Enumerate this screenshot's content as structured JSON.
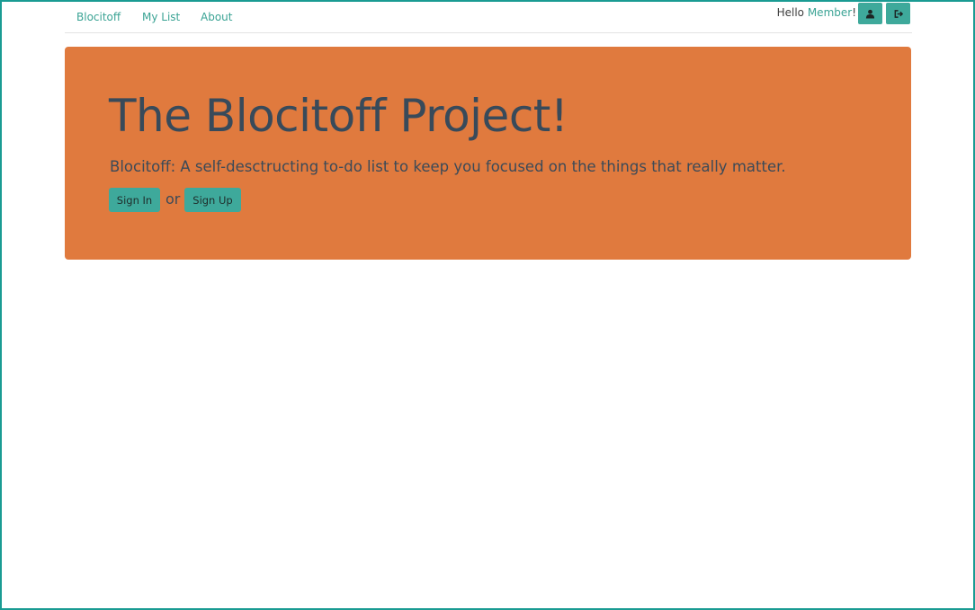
{
  "nav": {
    "links": [
      "Blocitoff",
      "My List",
      "About"
    ],
    "greeting_prefix": "Hello ",
    "member_name": "Member",
    "greeting_suffix": "!"
  },
  "icons": {
    "profile": "user-icon",
    "logout": "sign-out-icon"
  },
  "hero": {
    "title": "The Blocitoff Project!",
    "tagline": "Blocitoff: A self-desctructing to-do list to keep you focused on the things that really matter.",
    "sign_in_label": "Sign In",
    "or_text": "or",
    "sign_up_label": "Sign Up"
  },
  "colors": {
    "accent": "#3ea99b",
    "hero_bg": "#e07a3e",
    "heading": "#384a5a",
    "frame": "#1a9b93"
  }
}
